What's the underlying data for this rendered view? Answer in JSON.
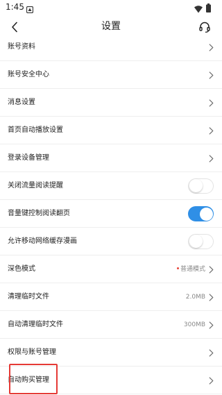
{
  "status_bar": {
    "time": "1:45"
  },
  "header": {
    "title": "设置"
  },
  "settings": {
    "items": [
      {
        "label": "账号资料",
        "control": "chevron"
      },
      {
        "label": "账号安全中心",
        "control": "chevron"
      },
      {
        "label": "消息设置",
        "control": "chevron"
      },
      {
        "label": "首页自动播放设置",
        "control": "chevron"
      },
      {
        "label": "登录设备管理",
        "control": "chevron"
      },
      {
        "label": "关闭流量阅读提醒",
        "control": "toggle",
        "on": false
      },
      {
        "label": "音量键控制阅读翻页",
        "control": "toggle",
        "on": true
      },
      {
        "label": "允许移动网络缓存漫画",
        "control": "toggle",
        "on": false
      },
      {
        "label": "深色模式",
        "control": "chevron",
        "value": "普通模式",
        "has_dot": true
      },
      {
        "label": "清理临时文件",
        "control": "chevron",
        "value": "2.0MB"
      },
      {
        "label": "自动清理临时文件",
        "control": "chevron",
        "value": "300MB"
      },
      {
        "label": "权限与账号管理",
        "control": "chevron"
      },
      {
        "label": "自动购买管理",
        "control": "chevron",
        "highlighted": true
      }
    ]
  },
  "colors": {
    "accent": "#2f8fe6",
    "highlight": "#e53935",
    "dot": "#e8463c"
  }
}
